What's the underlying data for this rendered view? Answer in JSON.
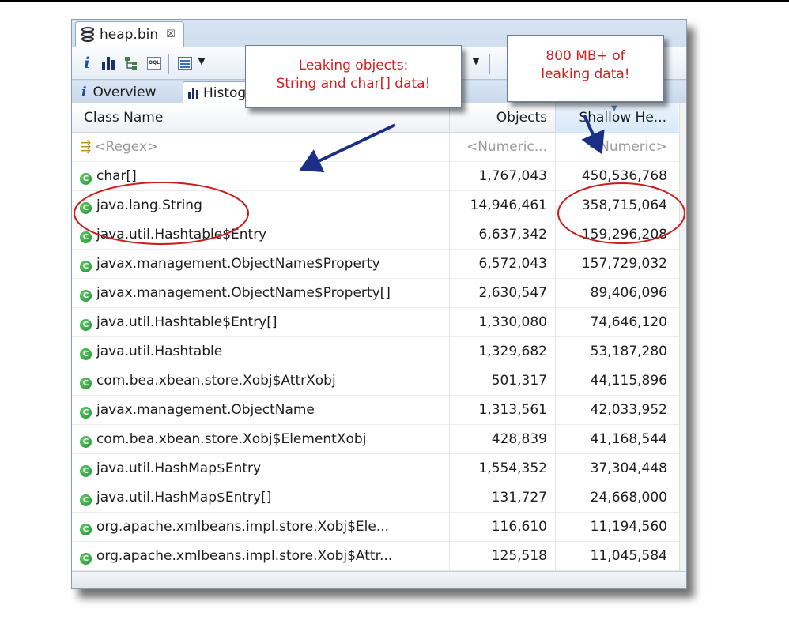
{
  "editor_tab": {
    "title": "heap.bin",
    "close_glyph": "☒",
    "icon": "database-icon"
  },
  "toolbar": {
    "info_glyph": "i",
    "oql_label": "OQL",
    "dropdown_glyph": "▼"
  },
  "subtabs": [
    {
      "label": "Overview",
      "icon": "info-icon",
      "active": false
    },
    {
      "label": "Histogram",
      "icon": "histogram-icon",
      "active": true
    }
  ],
  "table": {
    "headers": {
      "class_name": "Class Name",
      "objects": "Objects",
      "shallow": "Shallow He..."
    },
    "sort_glyph": "▼",
    "filter": {
      "icon": "regex-filter-icon",
      "class_name": "<Regex>",
      "objects": "<Numeric...",
      "shallow": "<Numeric>"
    },
    "class_icon_letter": "C",
    "rows": [
      {
        "class_name": "char[]",
        "objects": "1,767,043",
        "shallow": "450,536,768"
      },
      {
        "class_name": "java.lang.String",
        "objects": "14,946,461",
        "shallow": "358,715,064"
      },
      {
        "class_name": "java.util.Hashtable$Entry",
        "objects": "6,637,342",
        "shallow": "159,296,208"
      },
      {
        "class_name": "javax.management.ObjectName$Property",
        "objects": "6,572,043",
        "shallow": "157,729,032"
      },
      {
        "class_name": "javax.management.ObjectName$Property[]",
        "objects": "2,630,547",
        "shallow": "89,406,096"
      },
      {
        "class_name": "java.util.Hashtable$Entry[]",
        "objects": "1,330,080",
        "shallow": "74,646,120"
      },
      {
        "class_name": "java.util.Hashtable",
        "objects": "1,329,682",
        "shallow": "53,187,280"
      },
      {
        "class_name": "com.bea.xbean.store.Xobj$AttrXobj",
        "objects": "501,317",
        "shallow": "44,115,896"
      },
      {
        "class_name": "javax.management.ObjectName",
        "objects": "1,313,561",
        "shallow": "42,033,952"
      },
      {
        "class_name": "com.bea.xbean.store.Xobj$ElementXobj",
        "objects": "428,839",
        "shallow": "41,168,544"
      },
      {
        "class_name": "java.util.HashMap$Entry",
        "objects": "1,554,352",
        "shallow": "37,304,448"
      },
      {
        "class_name": "java.util.HashMap$Entry[]",
        "objects": "131,727",
        "shallow": "24,668,000"
      },
      {
        "class_name": "org.apache.xmlbeans.impl.store.Xobj$Ele...",
        "objects": "116,610",
        "shallow": "11,194,560"
      },
      {
        "class_name": "org.apache.xmlbeans.impl.store.Xobj$Attr...",
        "objects": "125,518",
        "shallow": "11,045,584"
      }
    ]
  },
  "callouts": {
    "leak_line1": "Leaking objects:",
    "leak_line2": "String and char[] data!",
    "mb_line1": "800 MB+ of",
    "mb_line2": "leaking data!"
  },
  "colors": {
    "annotation_red": "#c81e1e",
    "arrow_navy": "#1c2f86",
    "callout_text": "#d02121"
  }
}
